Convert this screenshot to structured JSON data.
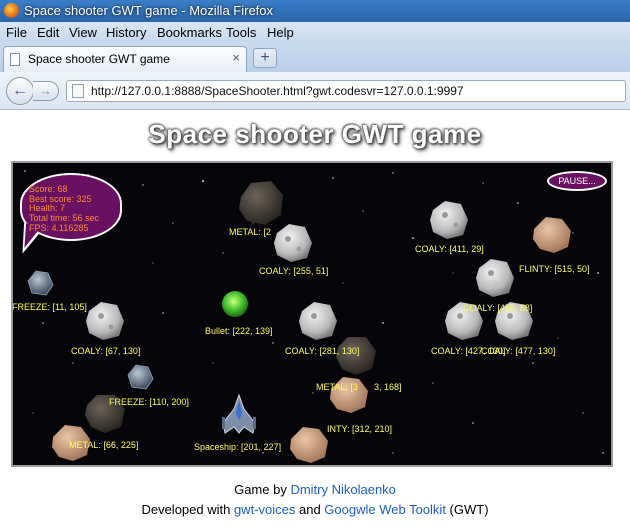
{
  "window": {
    "title": "Space shooter GWT game - Mozilla Firefox"
  },
  "menu": {
    "items": [
      "File",
      "Edit",
      "View",
      "History",
      "Bookmarks",
      "Tools",
      "Help"
    ]
  },
  "tab": {
    "title": "Space shooter GWT game",
    "close": "×",
    "new_tab": "+"
  },
  "nav": {
    "back": "←",
    "forward": "→",
    "url": "http://127.0.0.1:8888/SpaceShooter.html?gwt.codesvr=127.0.0.1:9997"
  },
  "page": {
    "heading": "Space shooter GWT game"
  },
  "game": {
    "hud": {
      "score": "Score: 68",
      "best": "Best score: 325",
      "health": "Health: 7",
      "time": "Total time: 56 sec",
      "fps": "FPS: 4.116285"
    },
    "pause": "PAUSE...",
    "labels": {
      "metal_top": "METAL: [2",
      "coaly_255": "COALY: [255, 51]",
      "coaly_411": "COALY: [411, 29]",
      "flinty_515": "FLINTY: [515, 50]",
      "overlap_88": "COALY: [455, 88]",
      "freeze_11": "FREEZE: [11, 105]",
      "bullet": "Bullet: [222, 139]",
      "coaly_67": "COALY: [67, 130]",
      "coaly_281": "COALY: [281, 130]",
      "coaly_427": "COALY: [427, 130]",
      "coaly_477": "COALY: [477, 130]",
      "metal_168": "METAL: [3",
      "metal_168_tail": "3, 168]",
      "freeze_110": "FREEZE: [110, 200]",
      "flinty_312": "INTY: [312, 210]",
      "metal_66": "METAL: [66, 225]",
      "spaceship": "Spaceship: [201, 227]"
    }
  },
  "footer": {
    "line1_prefix": "Game by ",
    "author": "Dmitry Nikolaenko",
    "line2_prefix": "Developed with ",
    "lib1": "gwt-voices",
    "and": " and ",
    "lib2": "Googwle Web Toolkit",
    "suffix": " (GWT)"
  }
}
